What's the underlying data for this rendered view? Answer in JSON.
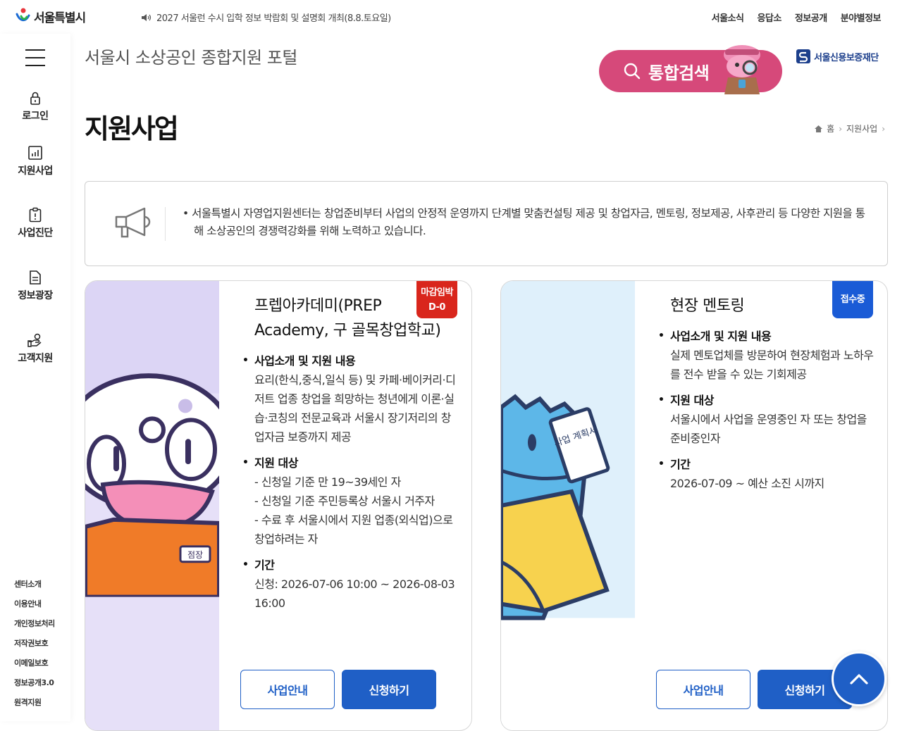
{
  "header": {
    "logo_text": "서울특별시",
    "notice": "2027 서울런 수시 입학 정보 박람회 및 설명회 개최(8.8.토요일)",
    "links": [
      "서울소식",
      "응답소",
      "정보공개",
      "분야별정보"
    ]
  },
  "sidebar": {
    "items": [
      {
        "label": "로그인",
        "icon": "lock-icon"
      },
      {
        "label": "지원사업",
        "icon": "chart-icon"
      },
      {
        "label": "사업진단",
        "icon": "clipboard-icon"
      },
      {
        "label": "정보광장",
        "icon": "document-icon"
      },
      {
        "label": "고객지원",
        "icon": "handshake-icon"
      }
    ],
    "footer_links": [
      "센터소개",
      "이용안내",
      "개인정보처리",
      "저작권보호",
      "이메일보호",
      "정보공개3.0",
      "원격지원"
    ]
  },
  "site": {
    "title": "서울시 소상공인 종합지원 포털",
    "search_label": "통합검색",
    "partner": "서울신용보증재단",
    "accent": "#d6497a"
  },
  "page": {
    "title": "지원사업",
    "breadcrumb": [
      "홈",
      "지원사업"
    ]
  },
  "notice": {
    "text": "서울특별시 자영업지원센터는 창업준비부터 사업의 안정적 운영까지 단계별 맞춤컨설팅 제공 및 창업자금, 멘토링, 정보제공, 사후관리 등 다양한 지원을 통해 소상공인의 경쟁력강화를 위해 노력하고 있습니다."
  },
  "cards": [
    {
      "title": "프렙아카데미(PREP Academy, 구 골목창업학교)",
      "badge_line1": "마감임박",
      "badge_line2": "D-0",
      "sec1_head": "사업소개 및 지원 내용",
      "sec1_text": "요리(한식,중식,일식 등) 및 카페·베이커리·디저트 업종 창업을 희망하는 청년에게 이론·실습·코칭의 전문교육과 서울시 장기저리의 창업자금 보증까지 제공",
      "sec2_head": "지원 대상",
      "sec2_lines": [
        "- 신청일 기준 만 19~39세인 자",
        "- 신청일 기준 주민등록상 서울시 거주자",
        "- 수료 후 서울시에서 지원 업종(외식업)으로 창업하려는 자"
      ],
      "sec3_head": "기간",
      "sec3_text": "신청: 2026-07-06 10:00 ~ 2026-08-03 16:00",
      "btn_info": "사업안내",
      "btn_apply": "신청하기",
      "mascot_tag": "점장"
    },
    {
      "title": "현장 멘토링",
      "badge": "접수중",
      "sec1_head": "사업소개 및 지원 내용",
      "sec1_text": "실제 멘토업체를 방문하여 현장체험과 노하우를 전수 받을 수 있는 기회제공",
      "sec2_head": "지원 대상",
      "sec2_text": "서울시에서 사업을 운영중인 자 또는 창업을 준비중인자",
      "sec3_head": "기간",
      "sec3_text": "2026-07-09 ~ 예산 소진 시까지",
      "btn_info": "사업안내",
      "btn_apply": "신청하기",
      "mascot_sign": "사업 계획서"
    }
  ],
  "colors": {
    "primary_blue": "#1f5fc6",
    "badge_red": "#d9261c",
    "badge_blue": "#1a5bd6"
  }
}
